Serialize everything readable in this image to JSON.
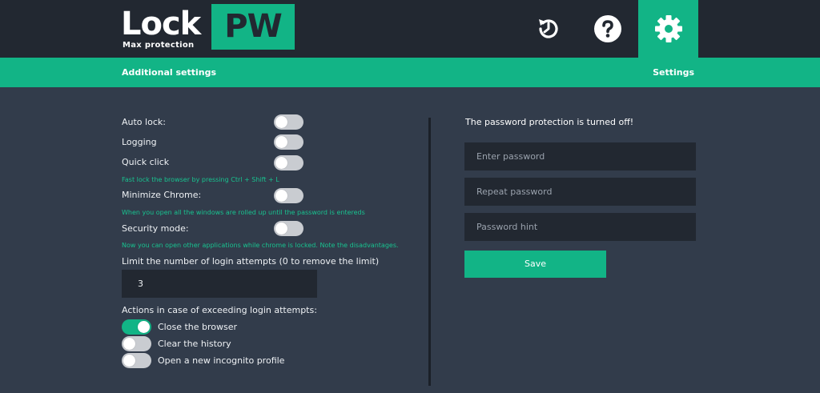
{
  "header": {
    "logo_word": "Lock",
    "logo_badge": "PW",
    "logo_tagline": "Max protection",
    "icons": [
      "history-icon",
      "help-icon",
      "gear-icon"
    ]
  },
  "tabs": {
    "additional": "Additional settings",
    "settings": "Settings"
  },
  "options": {
    "auto_lock": {
      "label": "Auto lock:",
      "on": false
    },
    "logging": {
      "label": "Logging",
      "on": false
    },
    "quick_click": {
      "label": "Quick click",
      "on": false,
      "hint": "Fast lock the browser by pressing Ctrl + Shift + L"
    },
    "minimize_chrome": {
      "label": "Minimize Chrome:",
      "on": false,
      "hint": "When you open all the windows are rolled up until the password is entereds"
    },
    "security_mode": {
      "label": "Security mode:",
      "on": false,
      "hint": "Now you can open other applications while chrome is locked. Note the disadvantages."
    }
  },
  "attempts": {
    "label": "Limit the number of login attempts (0 to remove the limit)",
    "value": "3"
  },
  "actions": {
    "label": "Actions in case of exceeding login attempts:",
    "close_browser": {
      "label": "Close the browser",
      "on": true
    },
    "clear_history": {
      "label": "Clear the history",
      "on": false
    },
    "incognito": {
      "label": "Open a new incognito profile",
      "on": false
    }
  },
  "password": {
    "status": "The password protection is turned off!",
    "enter_placeholder": "Enter password",
    "repeat_placeholder": "Repeat password",
    "hint_placeholder": "Password hint",
    "save_label": "Save"
  },
  "colors": {
    "accent": "#12b486",
    "header_bg": "#222831",
    "panel_bg": "#323c4b"
  }
}
